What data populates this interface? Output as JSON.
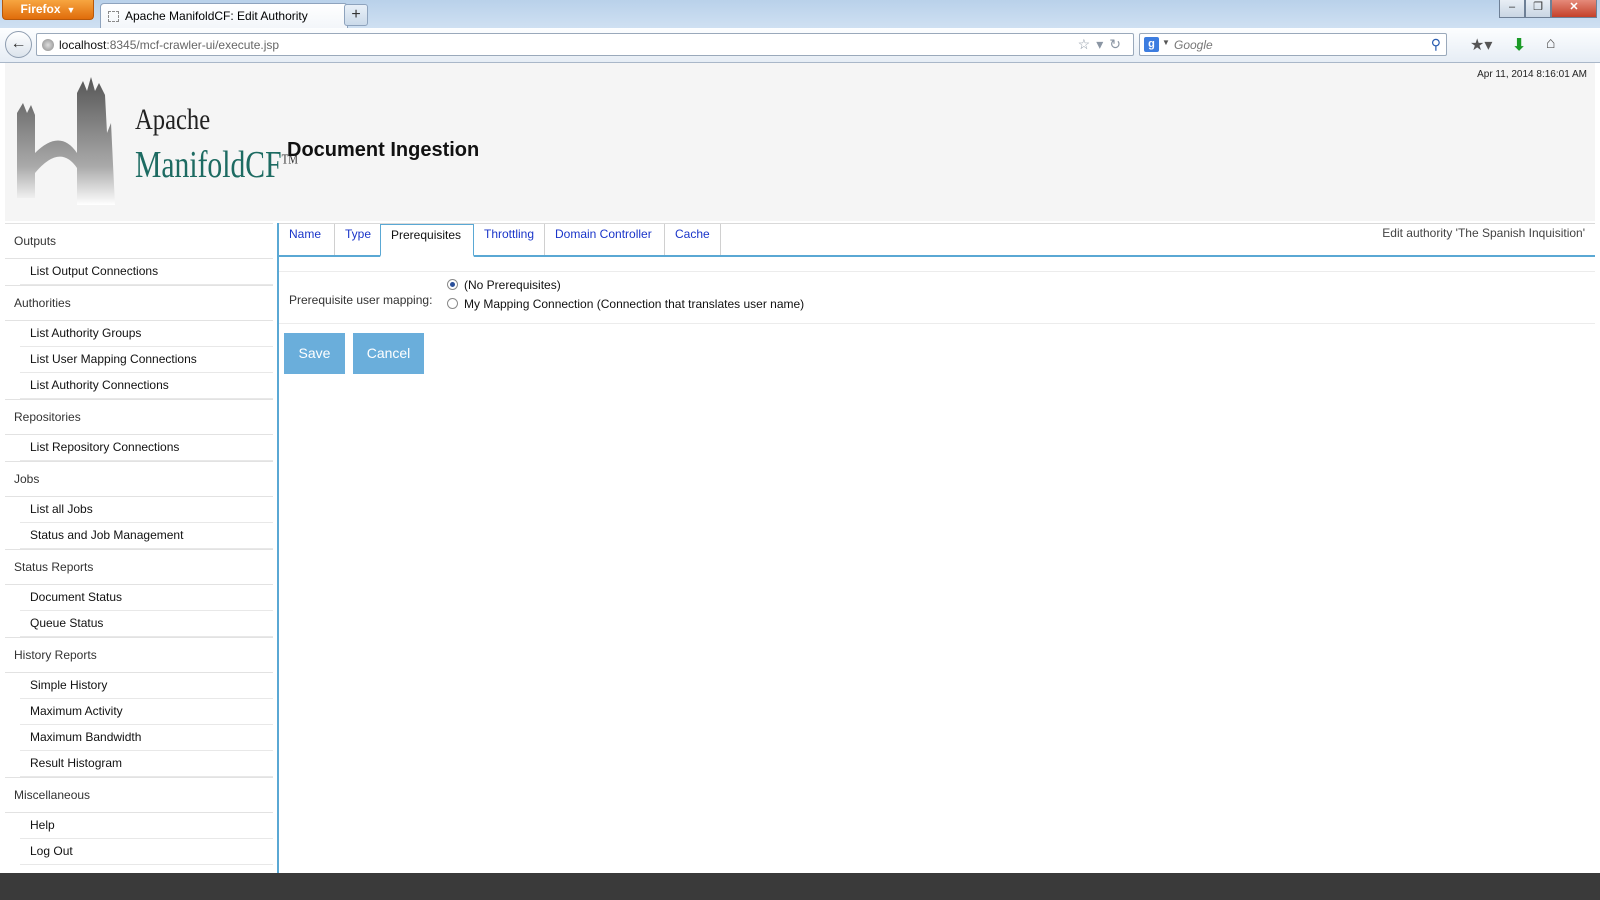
{
  "browser": {
    "app_button": "Firefox",
    "tab_title": "Apache ManifoldCF: Edit Authority",
    "new_tab": "+",
    "url_host": "localhost",
    "url_rest": ":8345/mcf-crawler-ui/execute.jsp",
    "search_placeholder": "Google",
    "search_engine_letter": "g"
  },
  "header": {
    "timestamp": "Apr 11, 2014 8:16:01 AM",
    "logo_line1": "Apache",
    "logo_line2": "ManifoldCF",
    "logo_tm": "TM",
    "title": "Document Ingestion"
  },
  "sidebar": {
    "sections": [
      {
        "label": "Outputs",
        "items": [
          "List Output Connections"
        ]
      },
      {
        "label": "Authorities",
        "items": [
          "List Authority Groups",
          "List User Mapping Connections",
          "List Authority Connections"
        ]
      },
      {
        "label": "Repositories",
        "items": [
          "List Repository Connections"
        ]
      },
      {
        "label": "Jobs",
        "items": [
          "List all Jobs",
          "Status and Job Management"
        ]
      },
      {
        "label": "Status Reports",
        "items": [
          "Document Status",
          "Queue Status"
        ]
      },
      {
        "label": "History Reports",
        "items": [
          "Simple History",
          "Maximum Activity",
          "Maximum Bandwidth",
          "Result Histogram"
        ]
      },
      {
        "label": "Miscellaneous",
        "items": [
          "Help",
          "Log Out"
        ]
      }
    ]
  },
  "main": {
    "tabs": [
      "Name",
      "Type",
      "Prerequisites",
      "Throttling",
      "Domain Controller",
      "Cache"
    ],
    "active_tab": "Prerequisites",
    "edit_label": "Edit authority 'The Spanish Inquisition'",
    "form": {
      "label": "Prerequisite user mapping:",
      "options": [
        {
          "label": "(No Prerequisites)",
          "checked": true
        },
        {
          "label": "My Mapping Connection (Connection that translates user name)",
          "checked": false
        }
      ]
    },
    "save_label": "Save",
    "cancel_label": "Cancel"
  },
  "colors": {
    "accent": "#5aa8d4",
    "button": "#6aaedb",
    "link": "#1a35c9",
    "logo_teal": "#1d6b62"
  }
}
